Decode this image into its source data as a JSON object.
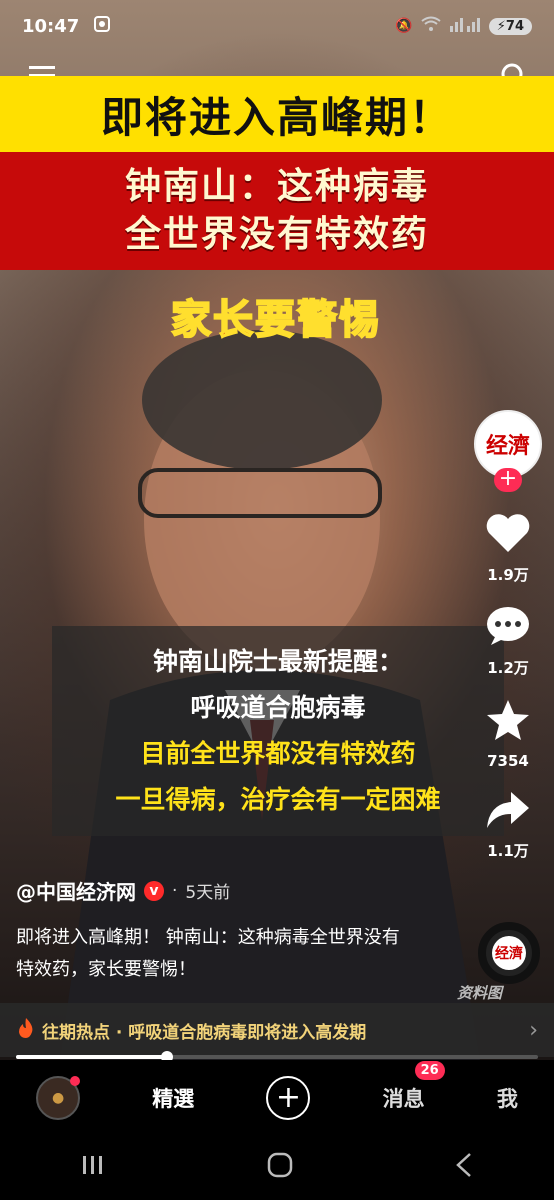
{
  "status_bar": {
    "time": "10:47",
    "battery": "74"
  },
  "video": {
    "title_yellow": "即将进入高峰期！",
    "title_red_line1": "钟南山：这种病毒",
    "title_red_line2": "全世界没有特效药",
    "warning": "家长要警惕",
    "caption_line1": "钟南山院士最新提醒：",
    "caption_line2": "呼吸道合胞病毒",
    "caption_line3": "目前全世界都没有特效药",
    "caption_line4": "一旦得病，治疗会有一定困难",
    "watermark": "资料图",
    "progress": 0.29
  },
  "side_actions": {
    "avatar_text": "经濟",
    "like_count": "1.9万",
    "comment_count": "1.2万",
    "favorite_count": "7354",
    "share_count": "1.1万",
    "music_text": "经濟"
  },
  "post": {
    "author": "@中国经济网",
    "verified_mark": "v",
    "separator": "·",
    "time": "5天前",
    "description": "即将进入高峰期！ 钟南山：这种病毒全世界没有特效药，家长要警惕！"
  },
  "hot_bar": {
    "text": "往期热点 · 呼吸道合胞病毒即将进入高发期"
  },
  "tab_bar": {
    "featured": "精選",
    "messages": "消息",
    "messages_badge": "26",
    "me": "我"
  },
  "colors": {
    "accent": "#fe2c55",
    "banner_yellow": "#ffe000",
    "banner_red": "#c60a0a",
    "caption_yellow": "#ffe21a"
  }
}
